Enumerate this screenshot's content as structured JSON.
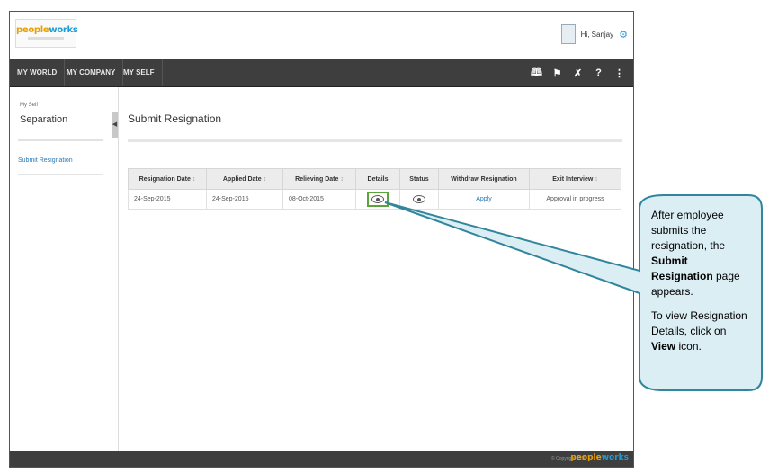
{
  "header": {
    "logo_text_a": "people",
    "logo_text_b": "works",
    "greeting": "Hi, Sanjay"
  },
  "nav": {
    "items": [
      "MY WORLD",
      "MY COMPANY",
      "MY SELF"
    ],
    "icons": [
      "book-icon",
      "flag-icon",
      "tools-icon",
      "help-icon",
      "share-icon"
    ]
  },
  "sidebar": {
    "section": "My Self",
    "title": "Separation",
    "link": "Submit Resignation"
  },
  "main": {
    "title": "Submit Resignation",
    "table": {
      "headers": [
        "Resignation Date",
        "Applied Date",
        "Relieving Date",
        "Details",
        "Status",
        "Withdraw Resignation",
        "Exit Interview"
      ],
      "sort_glyph": "↕",
      "rows": [
        {
          "resignation_date": "24-Sep-2015",
          "applied_date": "24-Sep-2015",
          "relieving_date": "08-Oct-2015",
          "withdraw": "Apply",
          "exit_interview": "Approval in progress"
        }
      ]
    }
  },
  "footer": {
    "copyright": "© Copyright 2015",
    "logo_text_a": "people",
    "logo_text_b": "works"
  },
  "callout": {
    "p1_a": "After employee submits the resignation, the ",
    "p1_bold": "Submit Resignation",
    "p1_b": " page appears.",
    "p2_a": "To view Resignation Details, click on ",
    "p2_bold": "View",
    "p2_b": " icon."
  },
  "colors": {
    "nav_bg": "#3e3e3e",
    "link": "#2a7ab8",
    "highlight": "#5aa43a",
    "callout_fill": "#daeef3",
    "callout_border": "#31859c"
  }
}
